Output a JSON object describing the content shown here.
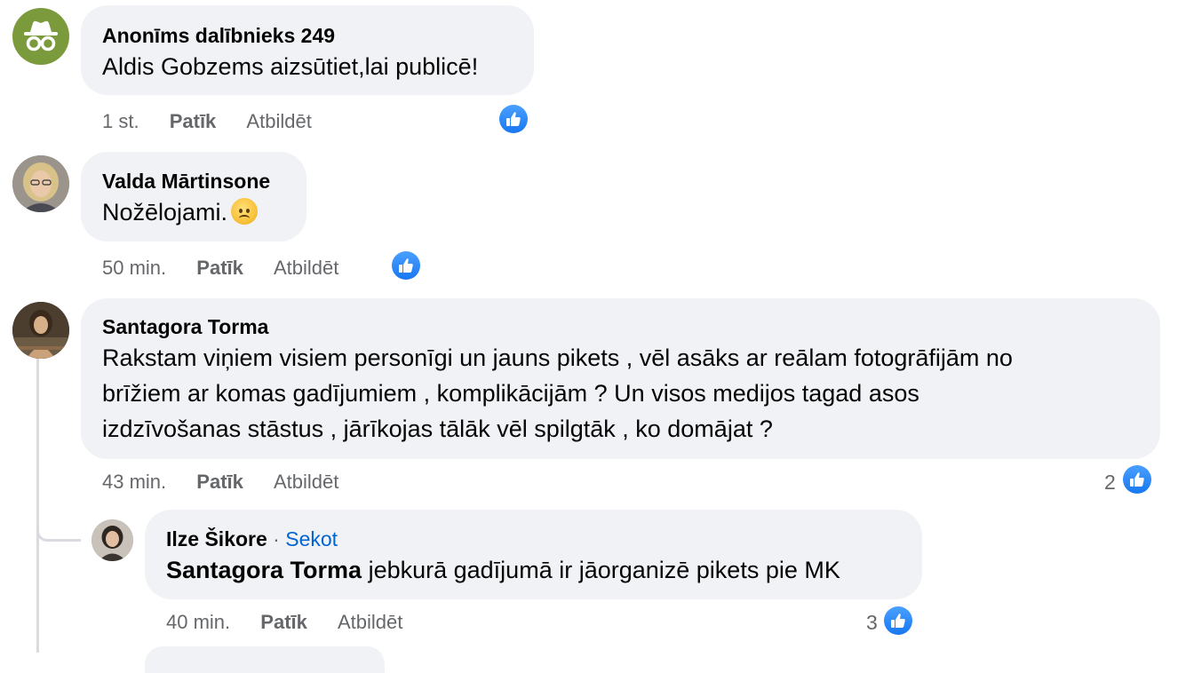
{
  "comments": [
    {
      "author": "Anonīms dalībnieks 249",
      "text": "Aldis Gobzems aizsūtiet,lai publicē!",
      "time": "1 st.",
      "like_label": "Patīk",
      "reply_label": "Atbildēt",
      "avatar": "incognito-icon",
      "avatar_color": "#7b9a3c"
    },
    {
      "author": "Valda Mārtinsone",
      "text": "Nožēlojami.",
      "emoji": "sad-face-emoji",
      "time": "50 min.",
      "like_label": "Patīk",
      "reply_label": "Atbildēt"
    },
    {
      "author": "Santagora Torma",
      "text_lines": [
        "Rakstam viņiem visiem personīgi un jauns pikets , vēl asāks ar reālam fotogrāfijām no",
        "brīžiem ar komas gadījumiem , komplikācijām ? Un visos medijos tagad asos",
        "izdzīvošanas stāstus , jārīkojas tālāk vēl spilgtāk , ko domājat ?"
      ],
      "time": "43 min.",
      "like_label": "Patīk",
      "reply_label": "Atbildēt",
      "reaction_count": "2"
    }
  ],
  "reply": {
    "author": "Ilze Šikore",
    "separator": "·",
    "follow_label": "Sekot",
    "mention": "Santagora Torma",
    "text": "jebkurā gadījumā ir jāorganizē pikets pie MK",
    "time": "40 min.",
    "like_label": "Patīk",
    "reply_label": "Atbildēt",
    "reaction_count": "3"
  },
  "colors": {
    "bubble": "#f0f2f5",
    "meta_text": "#65676b",
    "like_blue": "#1877f2",
    "follow_link": "#0064d1"
  },
  "icons": {
    "reaction": "thumbs-up-icon"
  }
}
